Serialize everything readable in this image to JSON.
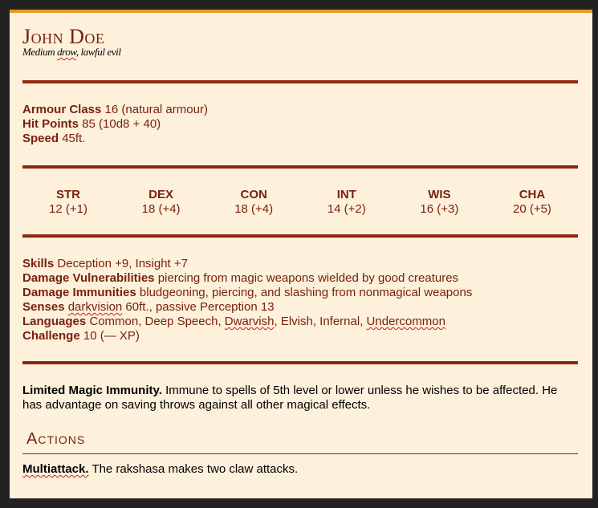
{
  "statblock": {
    "name": "John Doe",
    "subtitle": {
      "size": "Medium",
      "race": "drow",
      "alignment": "lawful evil"
    },
    "properties": [
      {
        "label": "Armour Class",
        "value": "16 (natural armour)"
      },
      {
        "label": "Hit Points",
        "value": "85 (10d8 + 40)"
      },
      {
        "label": "Speed",
        "value": "45ft."
      }
    ],
    "abilities": [
      {
        "name": "STR",
        "score": "12 (+1)"
      },
      {
        "name": "DEX",
        "score": "18 (+4)"
      },
      {
        "name": "CON",
        "score": "18 (+4)"
      },
      {
        "name": "INT",
        "score": "14 (+2)"
      },
      {
        "name": "WIS",
        "score": "16 (+3)"
      },
      {
        "name": "CHA",
        "score": "20 (+5)"
      }
    ],
    "details": {
      "skills": {
        "label": "Skills",
        "value": "Deception +9, Insight +7"
      },
      "vulnerabilities": {
        "label": "Damage Vulnerabilities",
        "value": "piercing from magic weapons wielded by good creatures"
      },
      "immunities": {
        "label": "Damage Immunities",
        "value": "bludgeoning, piercing, and slashing from nonmagical weapons"
      },
      "senses": {
        "label": "Senses",
        "term": "darkvision",
        "rest": "60ft., passive Perception 13"
      },
      "languages": {
        "label": "Languages",
        "a": "Common, Deep Speech,",
        "b": "Dwarvish",
        "c": ", Elvish, Infernal,",
        "d": "Undercommon"
      },
      "challenge": {
        "label": "Challenge",
        "value": "10 (— XP)"
      }
    },
    "trait": {
      "name": "Limited Magic Immunity.",
      "text": "Immune to spells of 5th level or lower unless he wishes to be affected. He has advantage on saving throws against all other magical effects."
    },
    "actions_heading": "Actions",
    "actions": [
      {
        "name": "Multiattack.",
        "text": "The rakshasa makes two claw attacks."
      }
    ]
  },
  "colors": {
    "accent_top": "#e69a28",
    "rule": "#922610",
    "text_red": "#7a200d",
    "parchment": "#fdf1dc",
    "background": "#222222"
  }
}
